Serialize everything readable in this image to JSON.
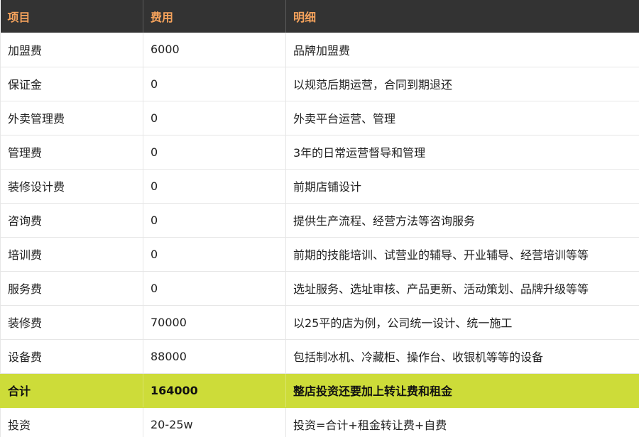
{
  "table": {
    "headers": [
      "项目",
      "费用",
      "明细"
    ],
    "rows": [
      [
        "加盟费",
        "6000",
        "品牌加盟费"
      ],
      [
        "保证金",
        "0",
        "以规范后期运营，合同到期退还"
      ],
      [
        "外卖管理费",
        "0",
        "外卖平台运营、管理"
      ],
      [
        "管理费",
        "0",
        "3年的日常运营督导和管理"
      ],
      [
        "装修设计费",
        "0",
        "前期店铺设计"
      ],
      [
        "咨询费",
        "0",
        "提供生产流程、经营方法等咨询服务"
      ],
      [
        "培训费",
        "0",
        "前期的技能培训、试营业的辅导、开业辅导、经营培训等等"
      ],
      [
        "服务费",
        "0",
        "选址服务、选址审核、产品更新、活动策划、品牌升级等等"
      ],
      [
        "装修费",
        "70000",
        "以25平的店为例，公司统一设计、统一施工"
      ],
      [
        "设备费",
        "88000",
        "包括制冰机、冷藏柜、操作台、收银机等等的设备"
      ],
      [
        "合计",
        "164000",
        "整店投资还要加上转让费和租金"
      ],
      [
        "投资",
        "20-25w",
        "投资=合计+租金转让费+自费"
      ]
    ]
  },
  "colors": {
    "header_bg": "#333333",
    "header_text": "#f6a35c",
    "total_row_bg": "#cddc39"
  }
}
